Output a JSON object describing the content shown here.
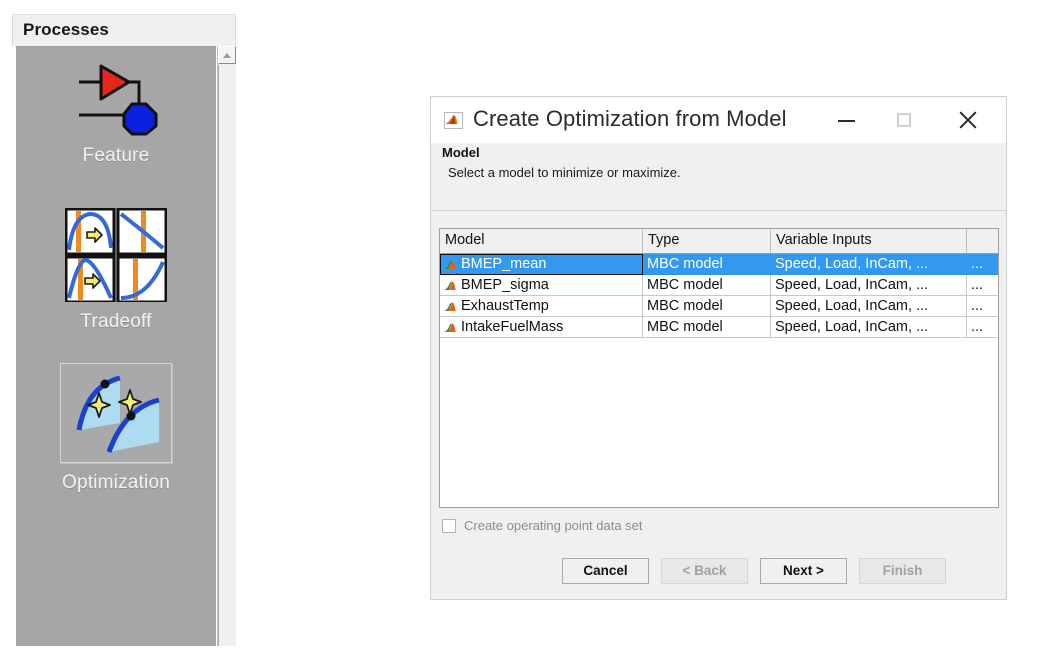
{
  "left_panel": {
    "header_title": "Processes",
    "scrollbar": {
      "up_arrow": "scroll-up-arrow"
    },
    "items": [
      {
        "label": "Feature",
        "icon": "feature-icon",
        "selected": false
      },
      {
        "label": "Tradeoff",
        "icon": "tradeoff-icon",
        "selected": false
      },
      {
        "label": "Optimization",
        "icon": "optimization-icon",
        "selected": true
      }
    ]
  },
  "dialog": {
    "title": "Create Optimization from Model",
    "icon": "matlab-membrane-icon",
    "window_buttons": {
      "minimize": "minimize-icon",
      "maximize": "maximize-icon",
      "close": "close-icon"
    },
    "section_title": "Model",
    "section_description": "Select a model to minimize or maximize.",
    "table": {
      "columns": [
        "Model",
        "Type",
        "Variable Inputs",
        ""
      ],
      "rows": [
        {
          "model": "BMEP_mean",
          "type": "MBC model",
          "variable_inputs": "Speed, Load, InCam, ...",
          "extra": "...",
          "icon": "mbc-model-icon",
          "selected": true
        },
        {
          "model": "BMEP_sigma",
          "type": "MBC model",
          "variable_inputs": "Speed, Load, InCam, ...",
          "extra": "...",
          "icon": "mbc-model-icon",
          "selected": false
        },
        {
          "model": "ExhaustTemp",
          "type": "MBC model",
          "variable_inputs": "Speed, Load, InCam, ...",
          "extra": "...",
          "icon": "mbc-model-icon",
          "selected": false
        },
        {
          "model": "IntakeFuelMass",
          "type": "MBC model",
          "variable_inputs": "Speed, Load, InCam, ...",
          "extra": "...",
          "icon": "mbc-model-icon",
          "selected": false
        }
      ]
    },
    "checkbox": {
      "label": "Create operating point data set",
      "checked": false,
      "enabled": false
    },
    "buttons": [
      {
        "label": "Cancel",
        "enabled": true
      },
      {
        "label": "< Back",
        "enabled": false
      },
      {
        "label": "Next >",
        "enabled": true
      },
      {
        "label": "Finish",
        "enabled": false
      }
    ]
  },
  "colors": {
    "selection_blue": "#3399f0",
    "panel_gray": "#a6a6a6",
    "dialog_bg": "#f0f0f0",
    "accent_orange": "#e8761e",
    "feature_red": "#e8251b",
    "feature_blue": "#0a22e0"
  }
}
